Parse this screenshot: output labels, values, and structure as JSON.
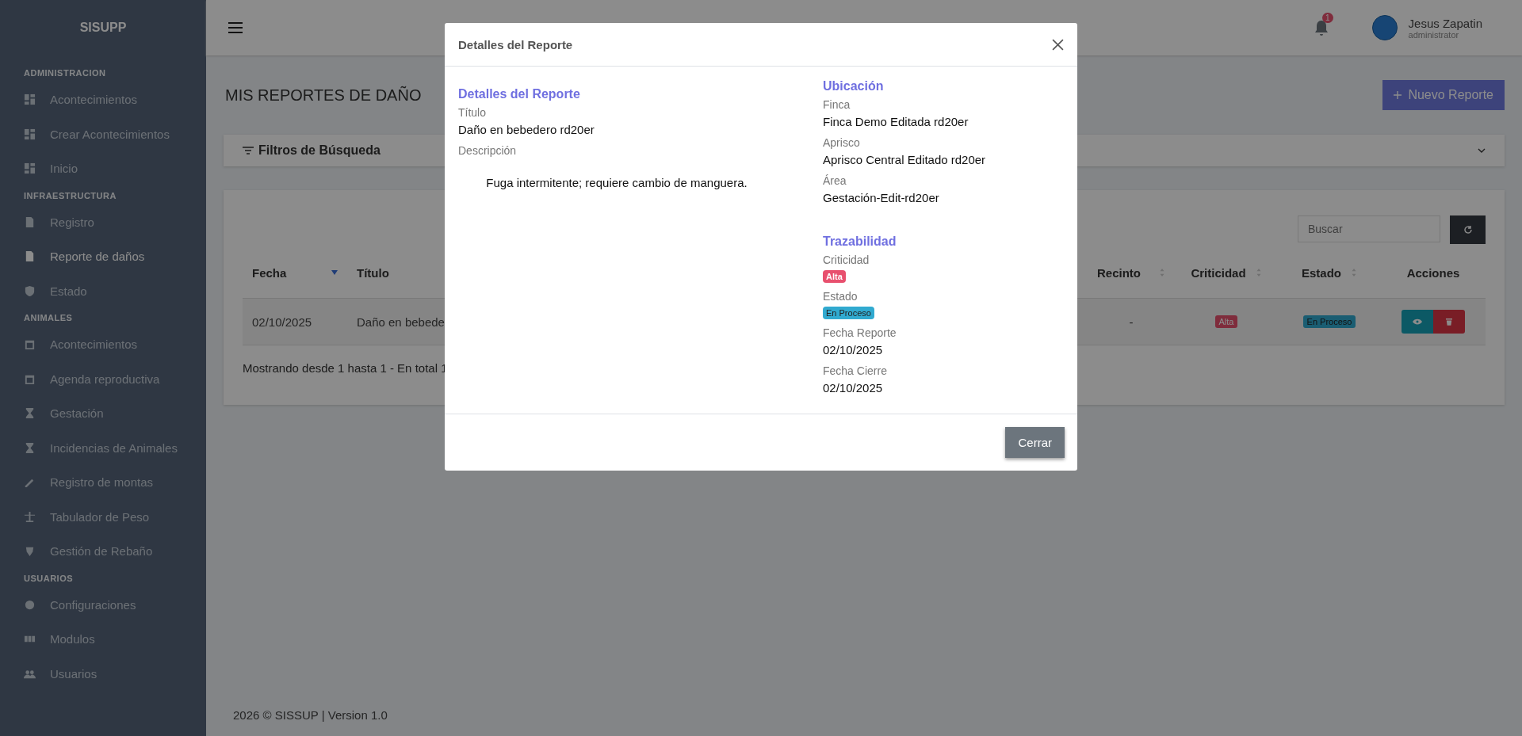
{
  "sidebar": {
    "brand": "SISUPP",
    "sections": [
      {
        "heading": "ADMINISTRACION",
        "items": [
          {
            "label": "Acontecimientos",
            "selected": false
          },
          {
            "label": "Crear Acontecimientos",
            "selected": false
          },
          {
            "label": "Inicio",
            "selected": false
          }
        ]
      },
      {
        "heading": "INFRAESTRUCTURA",
        "items": [
          {
            "label": "Registro",
            "selected": false
          },
          {
            "label": "Reporte de daños",
            "selected": true
          },
          {
            "label": "Estado",
            "selected": false
          }
        ]
      },
      {
        "heading": "ANIMALES",
        "items": [
          {
            "label": "Acontecimientos",
            "selected": false
          },
          {
            "label": "Agenda reproductiva",
            "selected": false
          },
          {
            "label": "Gestación",
            "selected": false
          },
          {
            "label": "Incidencias de Animales",
            "selected": false
          },
          {
            "label": "Registro de montas",
            "selected": false
          },
          {
            "label": "Tabulador de Peso",
            "selected": false
          },
          {
            "label": "Gestión de Rebaño",
            "selected": false
          }
        ]
      },
      {
        "heading": "USUARIOS",
        "items": [
          {
            "label": "Configuraciones",
            "selected": false
          },
          {
            "label": "Modulos",
            "selected": false
          },
          {
            "label": "Usuarios",
            "selected": false
          }
        ]
      }
    ]
  },
  "header": {
    "notification_count": "1",
    "user_name": "Jesus Zapatin",
    "user_role": "administrator"
  },
  "page": {
    "title": "MIS REPORTES DE DAÑO",
    "new_button": "Nuevo Reporte",
    "filters_title": "Filtros de Búsqueda",
    "search": {
      "placeholder": "Buscar"
    },
    "table": {
      "columns": [
        {
          "label": "Fecha",
          "sorted": true
        },
        {
          "label": "Título"
        },
        {
          "label": "Recinto",
          "sorted": false
        },
        {
          "label": "Criticidad",
          "sorted": false
        },
        {
          "label": "Estado",
          "sorted": false
        },
        {
          "label": "Acciones"
        }
      ],
      "rows": [
        {
          "fecha": "02/10/2025",
          "titulo": "Daño en bebede",
          "recinto": "-",
          "criticidad": "Alta",
          "estado": "En Proceso"
        }
      ]
    },
    "summary": "Mostrando desde 1 hasta 1 - En total 1"
  },
  "footer": "2026 © SISSUP | Version 1.0",
  "modal": {
    "title": "Detalles del Reporte",
    "left": {
      "heading": "Detalles del Reporte",
      "fields": [
        {
          "label": "Título",
          "kind": "text",
          "value": "Daño en bebedero rd20er"
        },
        {
          "label": "Descripción",
          "kind": "block",
          "value": "Fuga intermitente; requiere cambio de manguera."
        }
      ]
    },
    "right": [
      {
        "heading": "Ubicación",
        "fields": [
          {
            "label": "Finca",
            "kind": "text",
            "value": "Finca Demo Editada rd20er"
          },
          {
            "label": "Aprisco",
            "kind": "text",
            "value": "Aprisco Central Editado rd20er"
          },
          {
            "label": "Área",
            "kind": "text",
            "value": "Gestación-Edit-rd20er"
          }
        ]
      },
      {
        "heading": "Trazabilidad",
        "fields": [
          {
            "label": "Criticidad",
            "kind": "badge",
            "value": "Alta",
            "color": "#e8506e"
          },
          {
            "label": "Estado",
            "kind": "badge",
            "value": "En Proceso",
            "color": "#31aad0"
          },
          {
            "label": "Fecha Reporte",
            "kind": "text",
            "value": "02/10/2025"
          },
          {
            "label": "Fecha Cierre",
            "kind": "text",
            "value": "02/10/2025"
          }
        ]
      }
    ],
    "close_button": "Cerrar"
  }
}
